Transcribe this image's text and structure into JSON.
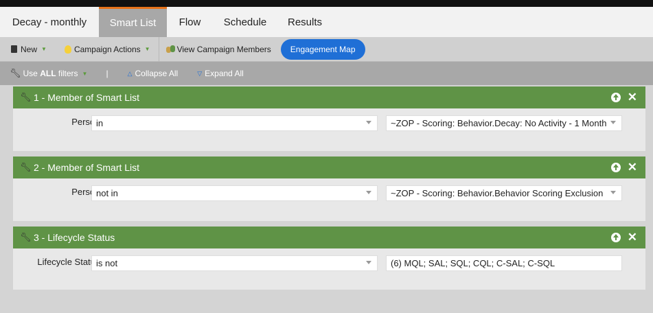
{
  "tabs": {
    "program_name": "Decay - monthly",
    "smart_list": "Smart List",
    "flow": "Flow",
    "schedule": "Schedule",
    "results": "Results"
  },
  "toolbar": {
    "new": "New",
    "campaign_actions": "Campaign Actions",
    "view_members": "View Campaign Members",
    "engagement_map": "Engagement Map"
  },
  "filterbar": {
    "use_prefix": "Use",
    "use_all": "ALL",
    "use_suffix": "filters",
    "separator": "|",
    "collapse_all": "Collapse All",
    "expand_all": "Expand All"
  },
  "filters": [
    {
      "title": "1 - Member of Smart List",
      "label": "Person:",
      "operator": "in",
      "value": "~ZOP - Scoring: Behavior.Decay: No Activity - 1 Month"
    },
    {
      "title": "2 - Member of Smart List",
      "label": "Person:",
      "operator": "not in",
      "value": "~ZOP - Scoring: Behavior.Behavior Scoring Exclusion"
    },
    {
      "title": "3 - Lifecycle Status",
      "label": "Lifecycle Status:",
      "operator": "is not",
      "value": "(6) MQL; SAL; SQL; CQL; C-SAL; C-SQL"
    }
  ],
  "colors": {
    "filter_header": "#5f9346",
    "active_tab_accent": "#e8731a",
    "engagement_button": "#1f6fd6"
  }
}
